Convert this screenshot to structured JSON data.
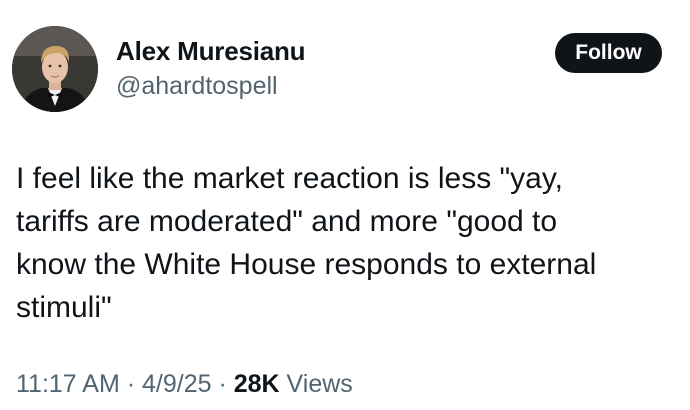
{
  "author": {
    "name": "Alex Muresianu",
    "handle": "@ahardtospell"
  },
  "follow_label": "Follow",
  "tweet": {
    "lines": [
      "I feel like the market reaction is less \"yay,",
      "tariffs are moderated\" and more \"good to",
      "know the White House responds to external",
      "stimuli\""
    ]
  },
  "meta": {
    "time": "11:17 AM",
    "sep1": " · ",
    "date": "4/9/25",
    "sep2": " · ",
    "views_count": "28K",
    "views_label": " Views"
  },
  "colors": {
    "text": "#0f1419",
    "secondary": "#536471",
    "button_bg": "#0f1419",
    "button_text": "#ffffff"
  }
}
